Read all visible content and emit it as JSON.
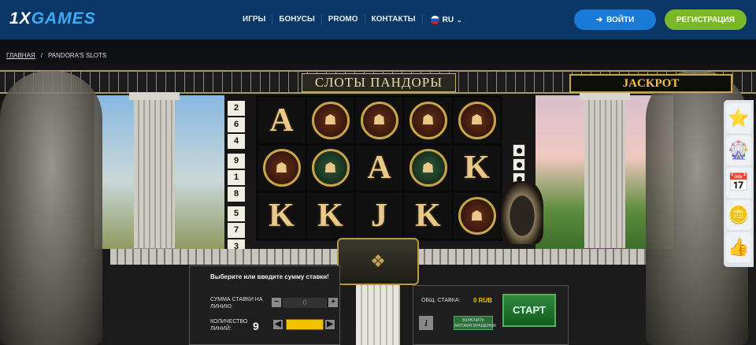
{
  "header": {
    "logo_prefix": "1X",
    "logo_suffix": "GAMES",
    "nav": [
      "ИГРЫ",
      "БОНУСЫ",
      "PROMO",
      "КОНТАКТЫ"
    ],
    "lang": "RU",
    "login": "ВОЙТИ",
    "register": "РЕГИСТРАЦИЯ"
  },
  "breadcrumb": {
    "home": "ГЛАВНАЯ",
    "separator": "/",
    "current": "PANDORA'S SLOTS"
  },
  "game": {
    "title": "СЛОТЫ ПАНДОРЫ",
    "jackpot": "JACKPOT",
    "left_lines": [
      "2",
      "6",
      "4",
      "9",
      "1",
      "8",
      "5",
      "7",
      "3"
    ],
    "reels": [
      [
        "A",
        "coin",
        "coin",
        "coin",
        "coin"
      ],
      [
        "coin",
        "coin-green",
        "A",
        "coin-green",
        "K"
      ],
      [
        "K",
        "K",
        "J",
        "K",
        "coin"
      ]
    ],
    "hint": "Выберите или введите сумму ставки!",
    "bet_label": "СУММА СТАВКИ НА ЛИНИЮ:",
    "bet_value": "0",
    "lines_label": "КОЛИЧЕСТВО ЛИНИЙ:",
    "lines_value": "9",
    "total_label": "ОБЩ. СТАВКА:",
    "total_value": "0 RUB",
    "start": "СТАРТ",
    "info": "i",
    "autoplay": "ВКЛЮЧИТЬ АВТОМАТ.ВРАЩЕНИЯ",
    "minus": "−",
    "plus": "+",
    "left_arrow": "◀",
    "right_arrow": "▶"
  },
  "sidebar": [
    "stars-icon",
    "wheel-icon",
    "calendar-icon",
    "coin-icon",
    "thumbs-up-icon"
  ]
}
